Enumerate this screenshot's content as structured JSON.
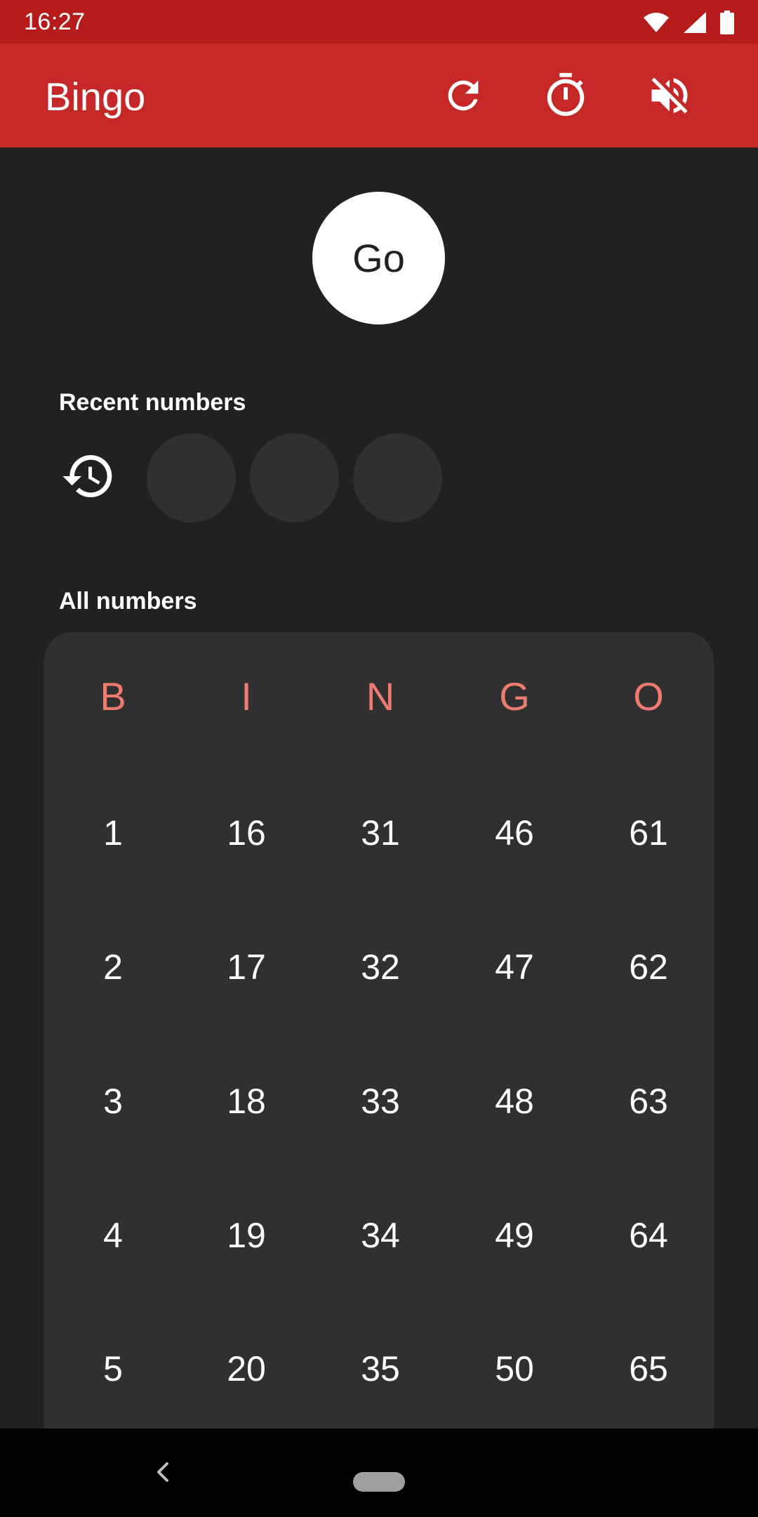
{
  "status_bar": {
    "time": "16:27",
    "icons": [
      "wifi-icon",
      "cellular-signal-icon",
      "battery-icon"
    ]
  },
  "app_bar": {
    "title": "Bingo",
    "actions": [
      "refresh-icon",
      "timer-icon",
      "volume-off-icon"
    ]
  },
  "go_button": {
    "label": "Go"
  },
  "recent": {
    "label": "Recent numbers",
    "history_icon": "history-icon",
    "slots": [
      "",
      "",
      ""
    ]
  },
  "all_numbers": {
    "label": "All numbers",
    "headers": [
      "B",
      "I",
      "N",
      "G",
      "O"
    ],
    "rows": [
      [
        "1",
        "16",
        "31",
        "46",
        "61"
      ],
      [
        "2",
        "17",
        "32",
        "47",
        "62"
      ],
      [
        "3",
        "18",
        "33",
        "48",
        "63"
      ],
      [
        "4",
        "19",
        "34",
        "49",
        "64"
      ],
      [
        "5",
        "20",
        "35",
        "50",
        "65"
      ]
    ]
  },
  "colors": {
    "status_bar": "#b71c1c",
    "app_bar": "#c62828",
    "background": "#212121",
    "board": "#303030",
    "header_letters": "#ef7a70"
  },
  "nav_bar": {
    "icons": [
      "back-icon",
      "home-pill-icon"
    ]
  }
}
